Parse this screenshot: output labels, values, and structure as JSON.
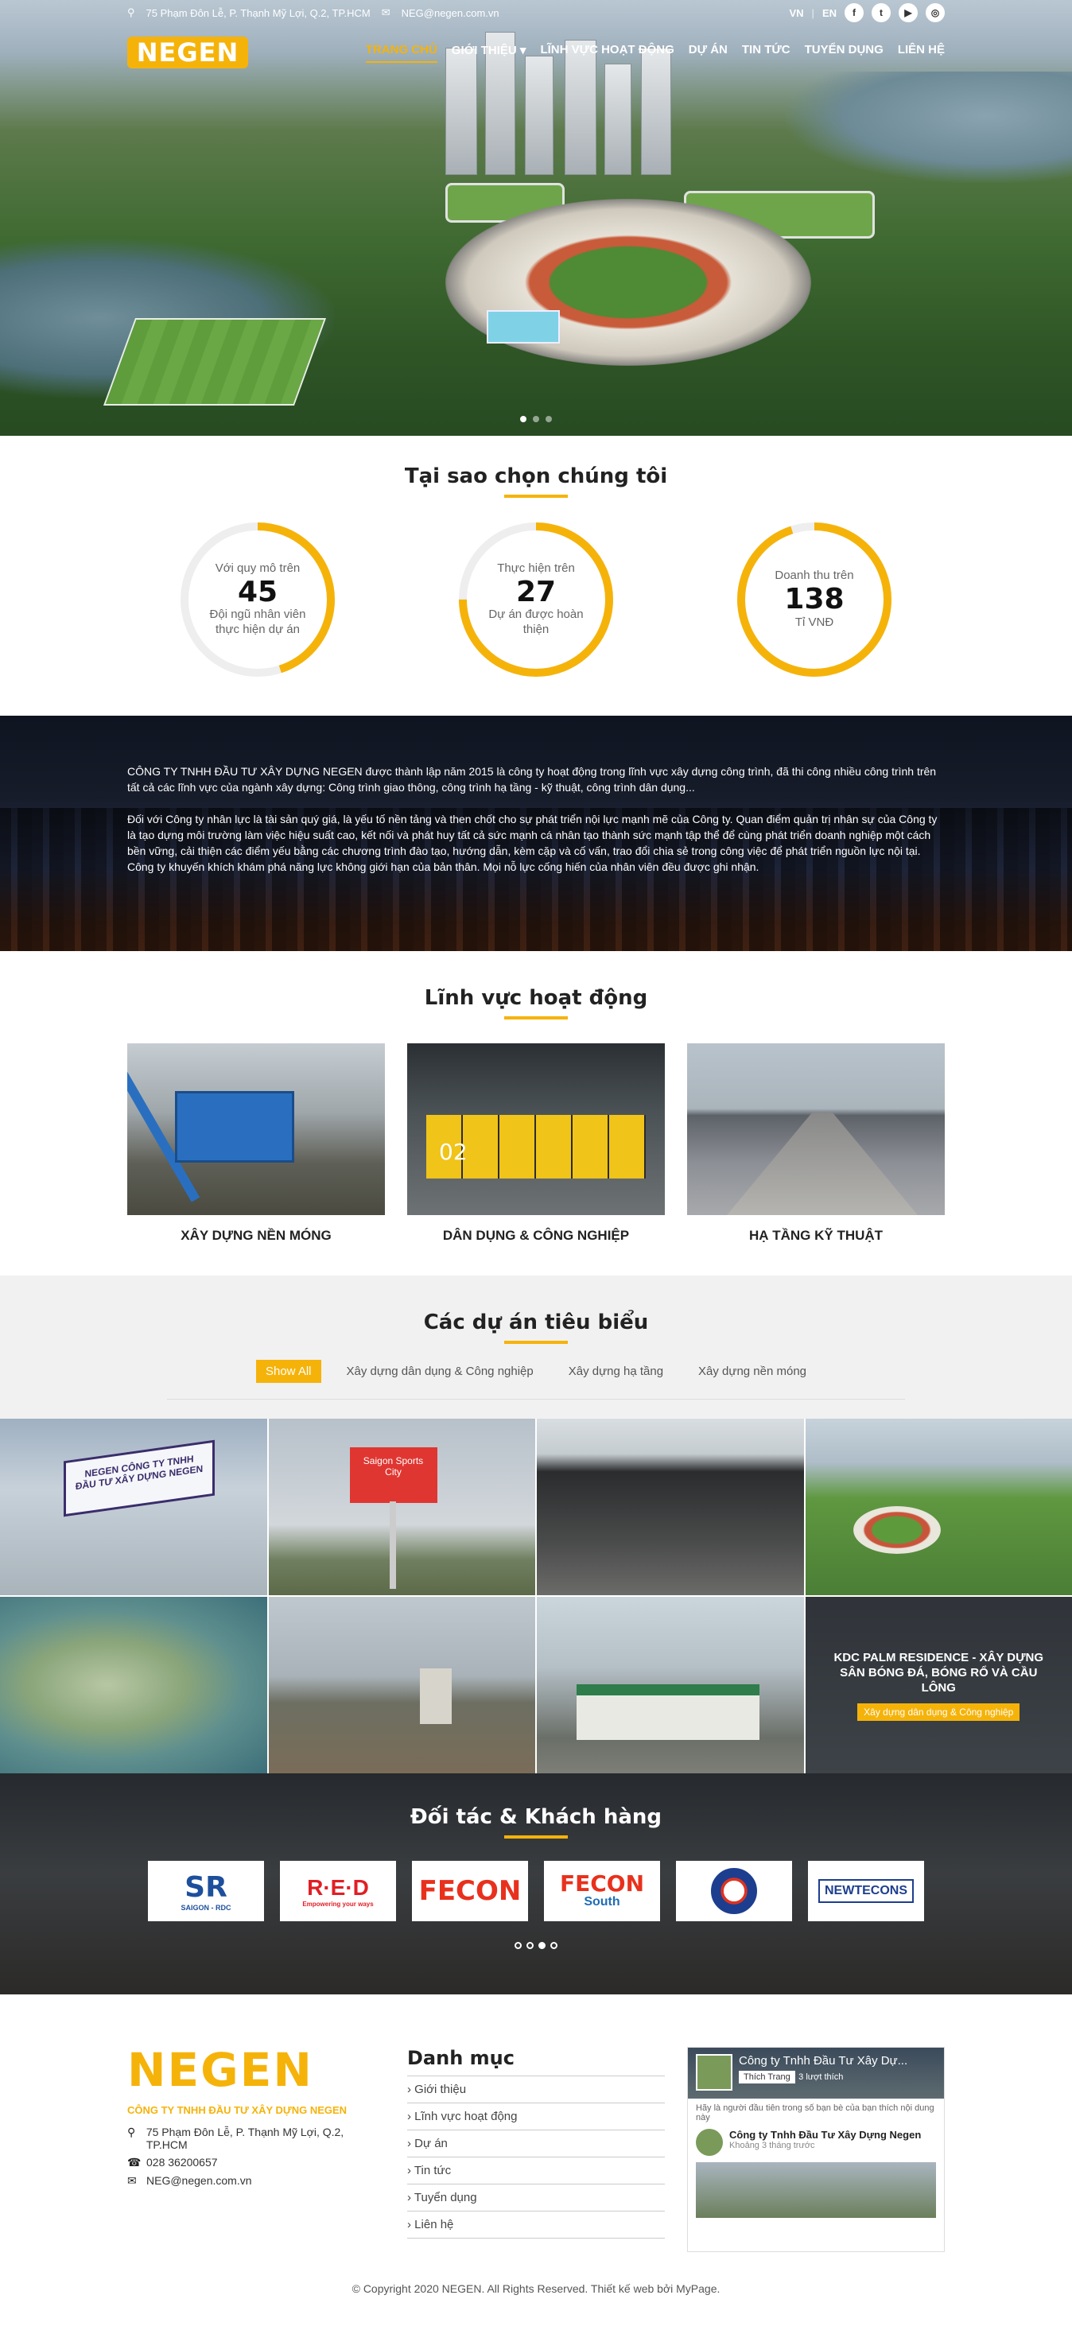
{
  "topbar": {
    "address": "75 Phạm Đôn Lễ, P. Thạnh Mỹ Lợi, Q.2, TP.HCM",
    "email": "NEG@negen.com.vn",
    "lang_vn": "VN",
    "lang_en": "EN",
    "social": [
      "f",
      "t",
      "▶",
      "◎"
    ]
  },
  "nav": {
    "logo": "NEGEN",
    "items": [
      "TRANG CHỦ",
      "GIỚI THIỆU ▾",
      "LĨNH VỰC HOẠT ĐỘNG",
      "DỰ ÁN",
      "TIN TỨC",
      "TUYỂN DỤNG",
      "LIÊN HỆ"
    ]
  },
  "why": {
    "title": "Tại sao chọn chúng tôi",
    "stats": [
      {
        "top": "Với quy mô trên",
        "num": "45",
        "bottom": "Đội ngũ nhân viên thực hiện dự án",
        "progress": 0.45
      },
      {
        "top": "Thực hiện trên",
        "num": "27",
        "bottom": "Dự án được hoàn thiện",
        "progress": 0.75
      },
      {
        "top": "Doanh thu trên",
        "num": "138",
        "bottom": "Tỉ VNĐ",
        "progress": 0.95
      }
    ]
  },
  "about": {
    "p1": "CÔNG TY TNHH ĐẦU TƯ XÂY DỰNG NEGEN được thành lập năm 2015 là công ty hoạt động trong lĩnh vực xây dựng công trình, đã thi công nhiều công trình trên tất cả các lĩnh vực của ngành xây dựng: Công trình giao thông, công trình hạ tầng - kỹ thuật, công trình dân dụng...",
    "p2": "Đối với Công ty nhân lực là tài sản quý giá, là yếu tố nền tảng và then chốt cho sự phát triển nội lực mạnh mẽ của Công ty. Quan điểm quản trị nhân sự của Công ty là tạo dựng môi trường làm việc hiệu suất cao, kết nối và phát huy tất cả sức mạnh cá nhân tạo thành sức mạnh tập thể để cùng phát triển doanh nghiệp một cách bền vững, cải thiện các điểm yếu bằng các chương trình đào tạo, hướng dẫn, kèm cặp và cố vấn, trao đổi chia sẻ trong công việc để phát triển nguồn lực nội tại. Công ty khuyến khích khám phá năng lực không giới hạn của bản thân. Mọi nỗ lực cống hiến của nhân viên đều được ghi nhận."
  },
  "fields": {
    "title": "Lĩnh vực hoạt động",
    "items": [
      {
        "label": "XÂY DỰNG NỀN MÓNG"
      },
      {
        "label": "DÂN DỤNG & CÔNG NGHIỆP",
        "overlay": "02"
      },
      {
        "label": "HẠ TẦNG KỸ THUẬT"
      }
    ]
  },
  "projects": {
    "title": "Các dự án tiêu biểu",
    "filters": [
      "Show All",
      "Xây dựng dân dụng & Công nghiệp",
      "Xây dựng hạ tầng",
      "Xây dựng nền móng"
    ],
    "sign1": "NEGEN CÔNG TY TNHH ĐẦU TƯ XÂY DỰNG NEGEN",
    "sign2": "Saigon Sports City",
    "featured_title": "KDC PALM RESIDENCE - XÂY DỰNG SÂN BÓNG ĐÁ, BÓNG RỔ VÀ CẦU LÔNG",
    "featured_tag": "Xây dựng dân dụng & Công nghiệp"
  },
  "partners": {
    "title": "Đối tác & Khách hàng",
    "logos": [
      {
        "big": "SR",
        "small": "SAIGON - RDC"
      },
      {
        "big": "R·E·D",
        "small": "Empowering your ways"
      },
      {
        "big": "FECON"
      },
      {
        "big": "FECON",
        "small": "South"
      },
      {
        "big": ""
      },
      {
        "big": "NEWTECONS"
      }
    ]
  },
  "footer": {
    "logo": "NEGEN",
    "company": "CÔNG TY TNHH ĐẦU TƯ XÂY DỰNG NEGEN",
    "address": "75 Phạm Đôn Lễ, P. Thạnh Mỹ Lợi, Q.2, TP.HCM",
    "phone": "028 36200657",
    "email": "NEG@negen.com.vn",
    "menu_title": "Danh mục",
    "menu": [
      "Giới thiệu",
      "Lĩnh vực hoạt động",
      "Dự án",
      "Tin tức",
      "Tuyển dụng",
      "Liên hệ"
    ],
    "fb": {
      "page": "Công ty Tnhh Đầu Tư Xây Dự...",
      "like": "Thích Trang",
      "followers": "3 lượt thích",
      "note": "Hãy là người đầu tiên trong số bạn bè của bạn thích nội dung này",
      "post_name": "Công ty Tnhh Đầu Tư Xây Dựng Negen",
      "post_time": "Khoảng 3 tháng trước"
    },
    "copyright": "© Copyright 2020 NEGEN. All Rights Reserved. Thiết kế web bởi MyPage."
  }
}
